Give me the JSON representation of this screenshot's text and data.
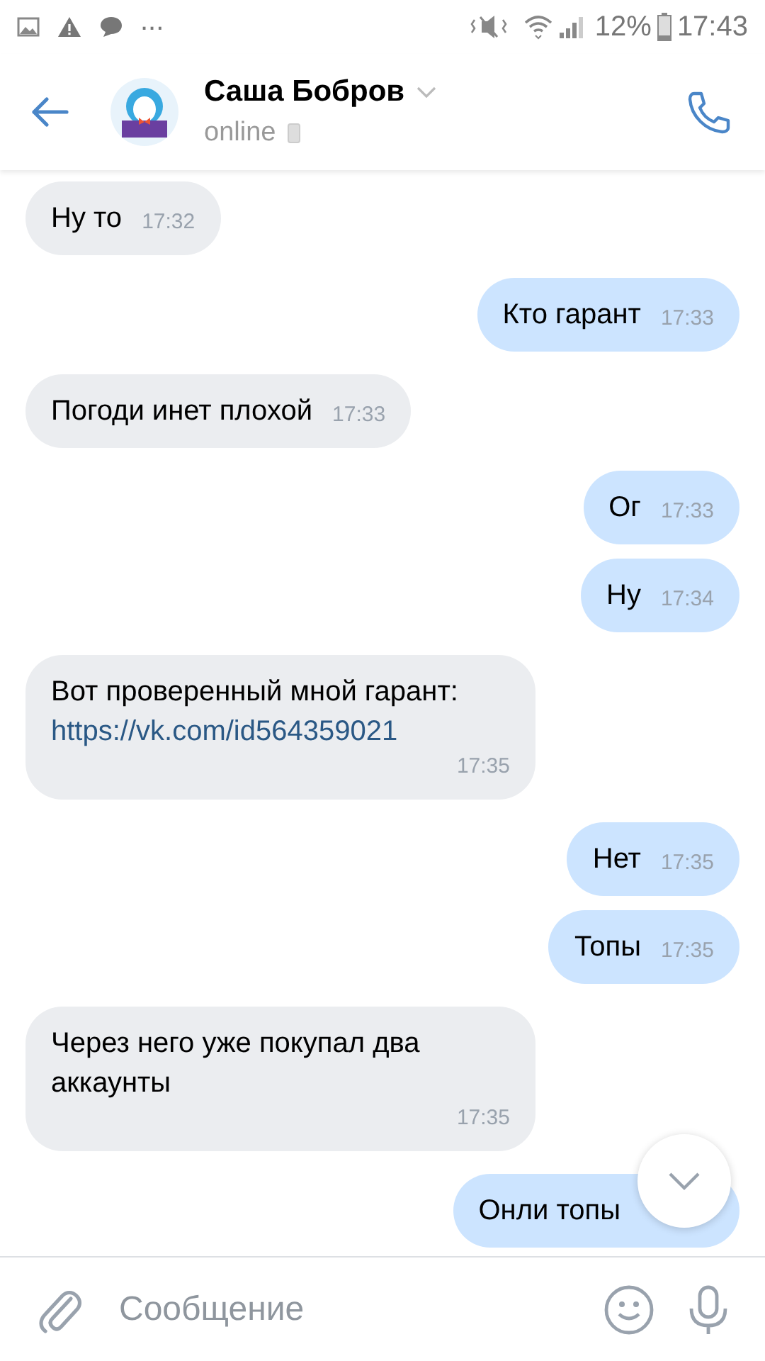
{
  "status_bar": {
    "more": "...",
    "battery": "12%",
    "time": "17:43"
  },
  "header": {
    "name": "Саша Бобров",
    "presence": "online"
  },
  "messages": [
    {
      "kind": "incoming",
      "text": "Ну то",
      "time": "17:32"
    },
    {
      "kind": "outgoing",
      "text": "Кто гарант",
      "time": "17:33"
    },
    {
      "kind": "incoming",
      "text": "Погоди инет плохой",
      "time": "17:33"
    },
    {
      "kind": "outgoing",
      "text": "Ог",
      "time": "17:33"
    },
    {
      "kind": "outgoing",
      "text": "Ну",
      "time": "17:34"
    },
    {
      "kind": "incoming",
      "text": "Вот проверенный мной гарант:",
      "link": "https://vk.com/id564359021",
      "time": "17:35"
    },
    {
      "kind": "outgoing",
      "text": "Нет",
      "time": "17:35"
    },
    {
      "kind": "outgoing",
      "text": "Топы",
      "time": "17:35"
    },
    {
      "kind": "incoming",
      "text": "Через него уже покупал два аккаунты",
      "time": "17:35"
    },
    {
      "kind": "outgoing",
      "text": "Онли топы"
    }
  ],
  "composer": {
    "placeholder": "Сообщение"
  }
}
